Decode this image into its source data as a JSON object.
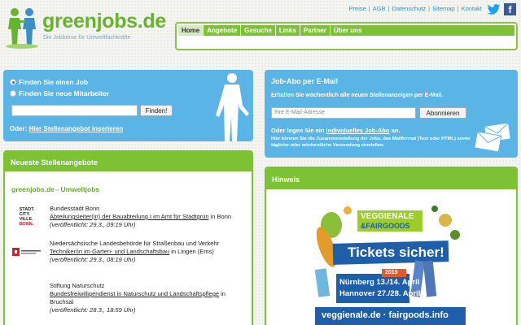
{
  "logo": {
    "text": "greenjobs.de",
    "tagline": "Die Jobbörse für Umweltfachkräfte"
  },
  "toplinks": [
    "Preise",
    "AGB",
    "Datenschutz",
    "Sitemap",
    "Kontakt"
  ],
  "social": {
    "twitter_icon": "twitter-icon",
    "facebook_icon": "facebook-icon",
    "facebook_glyph": "f"
  },
  "nav": [
    "Home",
    "Angebote",
    "Gesuche",
    "Links",
    "Partner",
    "Über uns"
  ],
  "search": {
    "radio1": "Finden Sie einen Job",
    "radio2": "Finden Sie neue Mitarbeiter",
    "input_value": "",
    "button": "Finden!",
    "oder": "Oder:",
    "oder_link": "Hier Stellenangebot inserieren"
  },
  "abo": {
    "title": "Job-Abo per E-Mail",
    "subtitle": "Erhalten Sie wöchentlich alle neuen Stellenanzeigen per E-Mail.",
    "placeholder": "Ihre E-Mail-Adresse",
    "button": "Abonnieren",
    "oder_prefix": "Oder legen Sie ein",
    "oder_link": "individuelles Job-Abo",
    "oder_suffix": "an.",
    "note": "Hier können Sie die Zusammenstellung der Jobs, das Mailformat (Text oder HTML) sowie tägliche oder wöchentliche Versendung einstellen."
  },
  "jobs": {
    "title": "Neueste Stellenangebote",
    "subtitle": "greenjobs.de - Umweltjobs",
    "items": [
      {
        "org": "Bundesstadt Bonn",
        "link": "Abteilungsleiter(in) der Bauabteilung I im Amt für Stadtgrün",
        "location": " in Bonn",
        "published": "(veröffentlicht: 29.3., 09:19 Uhr)",
        "logo_lines": [
          "STADT.",
          "CITY.",
          "VILLE.",
          "BONN."
        ]
      },
      {
        "org": "Niedersächsische Landesbehörde für Straßenbau und Verkehr",
        "link": "Techniker/in im Garten- und Landschaftsbau",
        "location": " in Lingen (Ems)",
        "published": "(veröffentlicht: 29.3., 08:19 Uhr)"
      },
      {
        "org": "Stiftung Naturschutz",
        "link": "Bundesfreiwilligendienst in Naturschutz und Landschaftspflege",
        "location": " in Bruchsal",
        "published": "(veröffentlicht: 28.3., 18:59 Uhr)"
      }
    ]
  },
  "hint": {
    "title": "Hinweis",
    "ad": {
      "brand_line1": "VEGGIENALE",
      "brand_line2": "&FAIRGOODS",
      "headline": "Tickets sicher!",
      "year": "2019",
      "event1": "Nürnberg 13./14. April",
      "event2": "Hannover 27./28. April",
      "footer": "veggienale.de · fairgoods.info"
    }
  },
  "colors": {
    "green": "#7cc234",
    "blue": "#5ab4e6",
    "link_blue": "#3a8fc5"
  }
}
